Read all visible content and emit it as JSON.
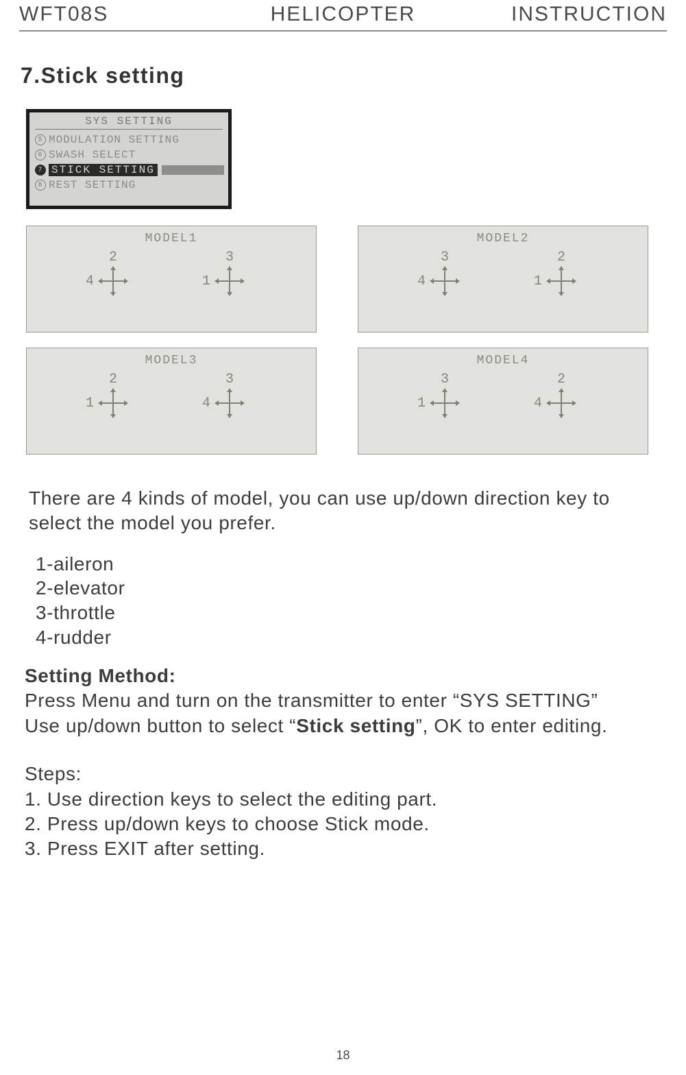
{
  "header": {
    "left": "WFT08S",
    "center": "HELICOPTER",
    "right": "INSTRUCTION"
  },
  "sectionTitle": "7.Stick setting",
  "sysSetting": {
    "title": "SYS SETTING",
    "rows": [
      {
        "num": "5",
        "label": "MODULATION SETTING",
        "selected": false
      },
      {
        "num": "6",
        "label": "SWASH SELECT",
        "selected": false
      },
      {
        "num": "7",
        "label": "STICK SETTING",
        "selected": true
      },
      {
        "num": "8",
        "label": "REST SETTING",
        "selected": false
      }
    ]
  },
  "models": [
    {
      "title": "MODEL1",
      "leftTop": "2",
      "leftSide": "4",
      "rightTop": "3",
      "rightSide": "1",
      "sidePos": "left-right"
    },
    {
      "title": "MODEL2",
      "leftTop": "3",
      "leftSide": "4",
      "rightTop": "2",
      "rightSide": "1",
      "sidePos": "left-right"
    },
    {
      "title": "MODEL3",
      "leftTop": "2",
      "leftSide": "1",
      "rightTop": "3",
      "rightSide": "4",
      "sidePos": "left-right-alt"
    },
    {
      "title": "MODEL4",
      "leftTop": "3",
      "leftSide": "1",
      "rightTop": "2",
      "rightSide": "4",
      "sidePos": "left-right-alt"
    }
  ],
  "intro": "There are 4 kinds of model, you can use up/down direction key to select the model you prefer.",
  "legend": {
    "l1": "1-aileron",
    "l2": "2-elevator",
    "l3": "3-throttle",
    "l4": "4-rudder"
  },
  "method": {
    "heading": "Setting Method:",
    "p1a": "Press Menu and turn on the transmitter to enter “SYS SETTING”",
    "p1b_prefix": "Use up/down button to select “",
    "p1b_bold": "Stick setting",
    "p1b_suffix": "”, OK  to enter editing."
  },
  "steps": {
    "heading": "Steps:",
    "s1": "1. Use direction keys to select the editing part.",
    "s2": "2. Press up/down keys to choose Stick mode.",
    "s3": "3. Press EXIT after setting."
  },
  "pageNumber": "18"
}
